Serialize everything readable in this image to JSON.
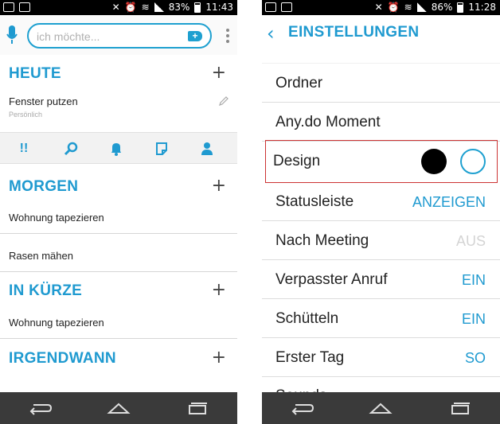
{
  "left_phone": {
    "status": {
      "battery": "83%",
      "time": "11:43"
    },
    "search": {
      "placeholder": "ich möchte..."
    },
    "sections": {
      "heute": {
        "title": "HEUTE"
      },
      "morgen": {
        "title": "MORGEN"
      },
      "in_kuerze": {
        "title": "IN KÜRZE"
      },
      "irgendwann": {
        "title": "IRGENDWANN"
      }
    },
    "tasks": {
      "heute_task": {
        "label": "Fenster putzen",
        "category": "Persönlich"
      },
      "morgen_task_1": {
        "label": "Wohnung tapezieren"
      },
      "morgen_task_2": {
        "label": "Rasen mähen"
      },
      "in_kuerze_task_1": {
        "label": "Wohnung tapezieren"
      }
    },
    "action_icons": [
      "priority-icon",
      "search-icon",
      "bell-icon",
      "note-icon",
      "person-icon"
    ],
    "action_priority_glyph": "!!"
  },
  "right_phone": {
    "status": {
      "battery": "86%",
      "time": "11:28"
    },
    "header": {
      "title": "EINSTELLUNGEN"
    },
    "rows": [
      {
        "label": "Ordner",
        "value": ""
      },
      {
        "label": "Any.do Moment",
        "value": ""
      },
      {
        "label": "Design",
        "value": ""
      },
      {
        "label": "Statusleiste",
        "value": "ANZEIGEN"
      },
      {
        "label": "Nach Meeting",
        "value": "AUS"
      },
      {
        "label": "Verpasster Anruf",
        "value": "EIN"
      },
      {
        "label": "Schütteln",
        "value": "EIN"
      },
      {
        "label": "Erster Tag",
        "value": "SO"
      },
      {
        "label": "Sounds",
        "value": ""
      }
    ]
  },
  "colors": {
    "accent": "#1f9ad0",
    "highlight_border": "#cc3333",
    "navbar": "#3a3a3a"
  }
}
